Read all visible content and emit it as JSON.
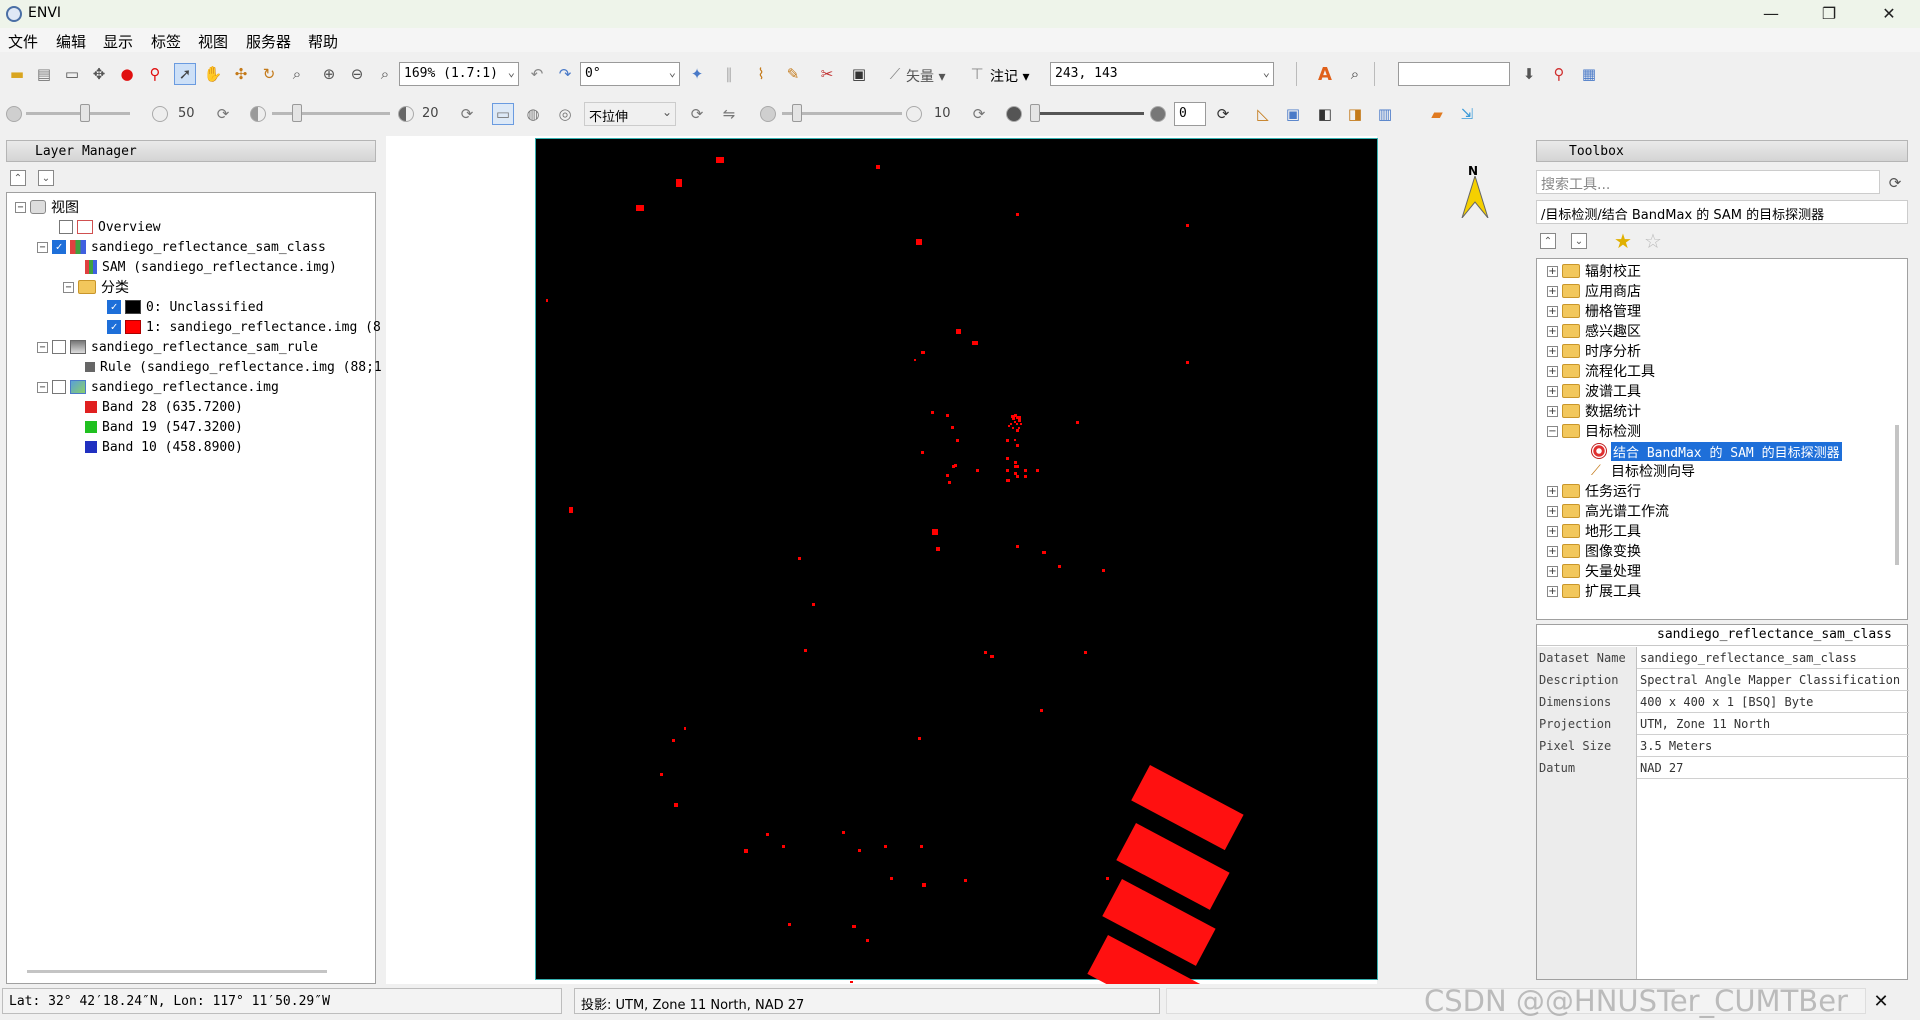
{
  "window": {
    "title": "ENVI",
    "minimize": "—",
    "maximize": "❐",
    "close": "✕"
  },
  "menu": [
    "文件",
    "编辑",
    "显示",
    "标签",
    "视图",
    "服务器",
    "帮助"
  ],
  "toolbar": {
    "zoom": "169% (1.7:1)",
    "rotation": "0°",
    "vector_label": "矢量",
    "annotation_label": "注记",
    "coords": "243, 143"
  },
  "toolbar2": {
    "brightness": "50",
    "contrast": "20",
    "stretch": "不拉伸",
    "sharpen": "10",
    "transparency": "0"
  },
  "layer_manager": {
    "title": "Layer Manager",
    "root": "视图",
    "overview": "Overview",
    "layer1": "sandiego_reflectance_sam_class",
    "layer1_child": "SAM (sandiego_reflectance.img)",
    "class_folder": "分类",
    "class0": "0: Unclassified",
    "class1": "1: sandiego_reflectance.img (8",
    "layer2": "sandiego_reflectance_sam_rule",
    "layer2_child": "Rule (sandiego_reflectance.img (88;1",
    "layer3": "sandiego_reflectance.img",
    "band_r": "Band 28 (635.7200)",
    "band_g": "Band 19 (547.3200)",
    "band_b": "Band 10 (458.8900)"
  },
  "north_arrow": "N",
  "toolbox": {
    "title": "Toolbox",
    "search_placeholder": "搜索工具...",
    "path": "/目标检测/结合 BandMax 的 SAM 的目标探测器",
    "folders": [
      "辐射校正",
      "应用商店",
      "栅格管理",
      "感兴趣区",
      "时序分析",
      "流程化工具",
      "波谱工具",
      "数据统计",
      "目标检测"
    ],
    "sub_items": [
      "结合 BandMax 的 SAM 的目标探测器",
      "目标检测向导"
    ],
    "folders_after": [
      "任务运行",
      "高光谱工作流",
      "地形工具",
      "图像变换",
      "矢量处理",
      "扩展工具"
    ]
  },
  "properties": {
    "header": "sandiego_reflectance_sam_class",
    "rows": [
      {
        "k": "Dataset Name",
        "v": "sandiego_reflectance_sam_class"
      },
      {
        "k": "Description",
        "v": "Spectral Angle Mapper Classification"
      },
      {
        "k": "Dimensions",
        "v": "400 x 400 x 1 [BSQ] Byte"
      },
      {
        "k": "Projection",
        "v": "UTM, Zone 11 North"
      },
      {
        "k": "Pixel Size",
        "v": "3.5 Meters"
      },
      {
        "k": "Datum",
        "v": "NAD 27"
      }
    ]
  },
  "status": {
    "latlon": "Lat: 32° 42′18.24″N, Lon: 117° 11′50.29″W",
    "projection": "投影:  UTM, Zone 11 North, NAD 27"
  },
  "watermark": "CSDN @@HNUSTer_CUMTBer",
  "colors": {
    "accent": "#1e6fd9",
    "class_red": "#ff0000",
    "image_bg": "#000000"
  }
}
